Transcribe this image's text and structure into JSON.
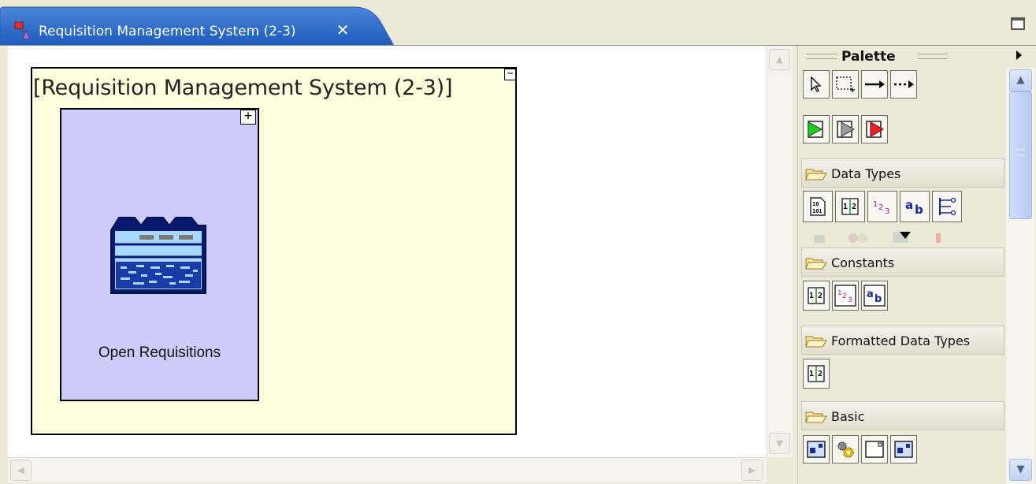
{
  "editor_tab": {
    "title": "Requisition Management System (2-3)",
    "close_glyph": "✕",
    "icon": "system-diagram-icon"
  },
  "canvas": {
    "frame": {
      "title": "[Requisition Management System (2-3)]",
      "collapse_glyph": "−"
    },
    "component": {
      "label": "Open Requisitions",
      "expand_glyph": "+",
      "icon": "datastore-icon",
      "fill_color": "#ccccf8"
    },
    "frame_fill_color": "#ffffe0"
  },
  "palette": {
    "title": "Palette",
    "tools": [
      {
        "name": "select-tool-icon"
      },
      {
        "name": "marquee-tool-icon"
      },
      {
        "name": "connection-tool-icon"
      },
      {
        "name": "dashed-connection-tool-icon"
      }
    ],
    "flow_tools": [
      {
        "name": "green-port-icon",
        "color": "#22cc22"
      },
      {
        "name": "gray-port-icon",
        "color": "#9a9a9a"
      },
      {
        "name": "red-port-icon",
        "color": "#ee2020"
      }
    ],
    "drawers": [
      {
        "label": "Data Types",
        "items": [
          "binary-type-icon",
          "decimal-type-icon",
          "integer-type-icon",
          "string-type-icon",
          "enumeration-type-icon"
        ]
      },
      {
        "label": "Constants",
        "items": [
          "decimal-constant-icon",
          "integer-constant-icon",
          "string-constant-icon"
        ]
      },
      {
        "label": "Formatted Data Types",
        "items": [
          "formatted-decimal-icon"
        ]
      },
      {
        "label": "Basic",
        "items": [
          "basic-component-icon",
          "gear-component-icon",
          "basic-frame-icon",
          "basic-window-icon"
        ]
      }
    ]
  }
}
